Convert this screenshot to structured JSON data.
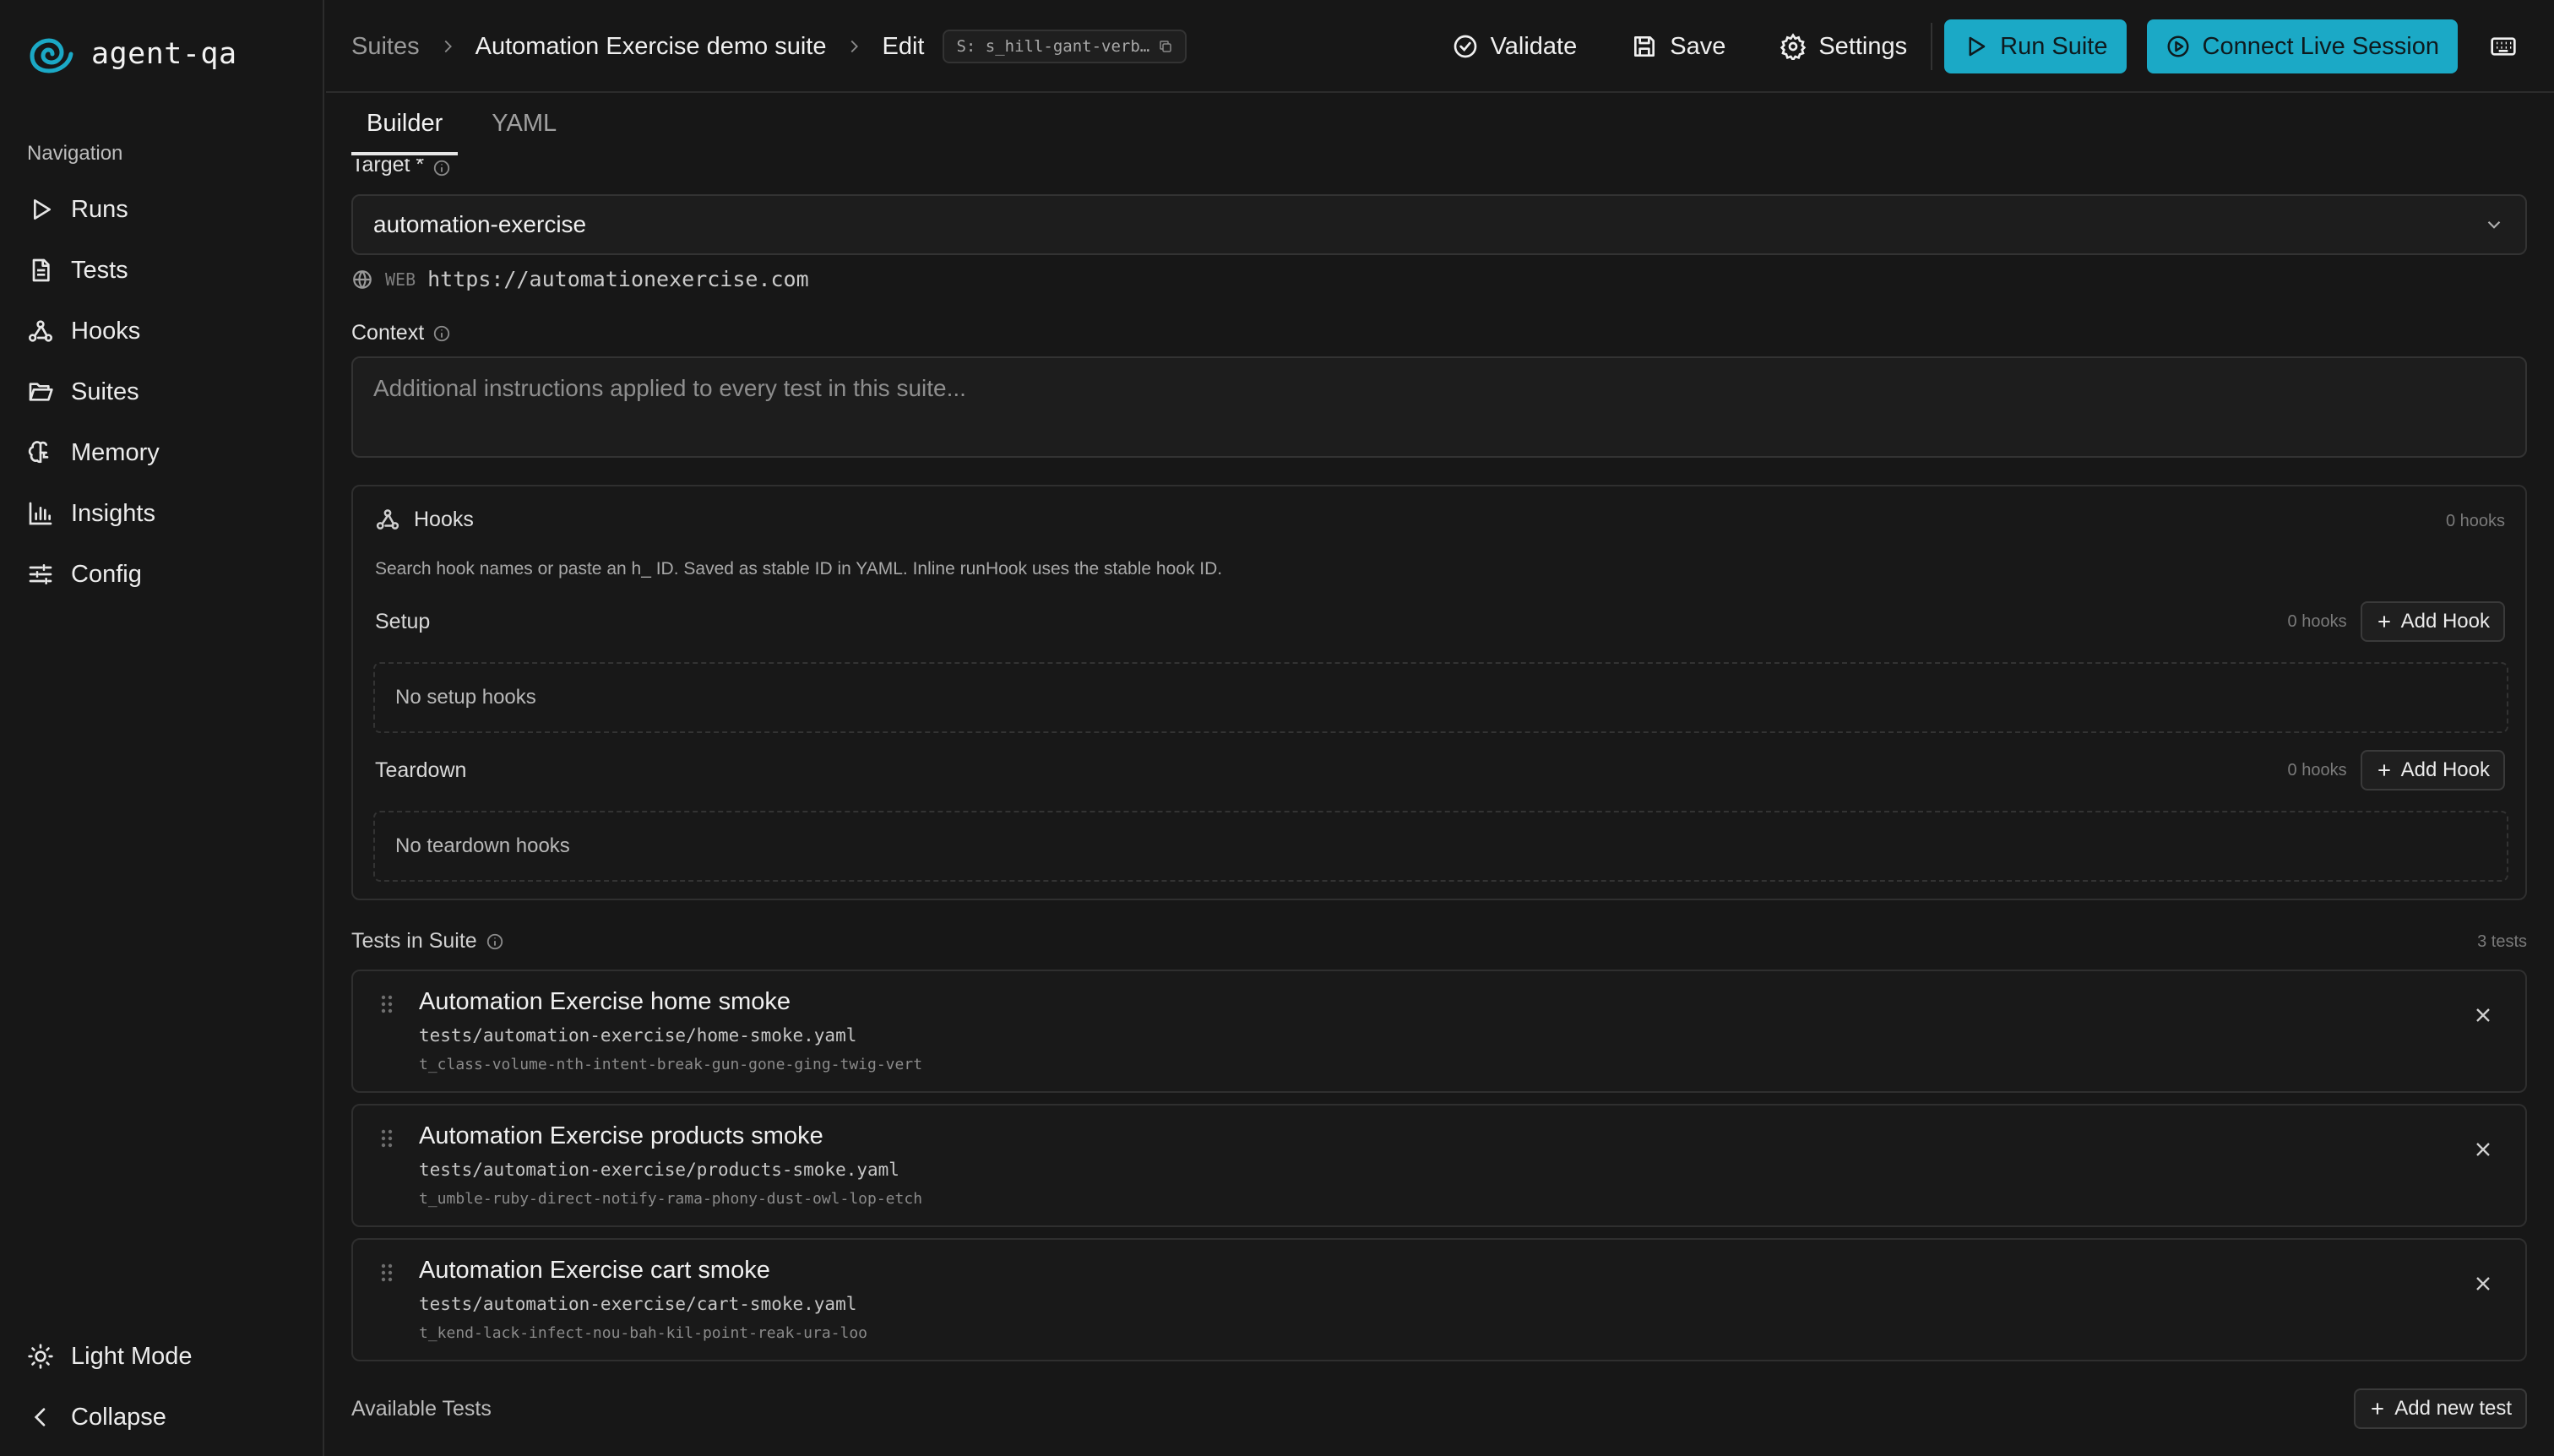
{
  "app": {
    "name": "agent-qa"
  },
  "sidebar": {
    "heading": "Navigation",
    "items": [
      {
        "label": "Runs",
        "icon": "play-icon"
      },
      {
        "label": "Tests",
        "icon": "file-text-icon"
      },
      {
        "label": "Hooks",
        "icon": "webhook-icon"
      },
      {
        "label": "Suites",
        "icon": "folder-open-icon"
      },
      {
        "label": "Memory",
        "icon": "brain-icon"
      },
      {
        "label": "Insights",
        "icon": "bar-chart-icon"
      },
      {
        "label": "Config",
        "icon": "sliders-icon"
      }
    ],
    "light_mode": "Light Mode",
    "collapse": "Collapse"
  },
  "header": {
    "crumb_suites": "Suites",
    "crumb_suite_name": "Automation Exercise demo suite",
    "crumb_edit": "Edit",
    "suite_id": "S: s_hill-gant-verb…",
    "validate": "Validate",
    "save": "Save",
    "settings": "Settings",
    "run_suite": "Run Suite",
    "connect_live": "Connect Live Session"
  },
  "tabs": {
    "builder": "Builder",
    "yaml": "YAML"
  },
  "form": {
    "target_label": "Target *",
    "target_value": "automation-exercise",
    "target_type": "WEB",
    "target_url": "https://automationexercise.com",
    "context_label": "Context",
    "context_placeholder": "Additional instructions applied to every test in this suite..."
  },
  "hooks": {
    "title": "Hooks",
    "count": "0 hooks",
    "description": "Search hook names or paste an h_ ID. Saved as stable ID in YAML. Inline runHook uses the stable hook ID.",
    "setup_label": "Setup",
    "setup_count": "0 hooks",
    "setup_empty": "No setup hooks",
    "teardown_label": "Teardown",
    "teardown_count": "0 hooks",
    "teardown_empty": "No teardown hooks",
    "add_hook": "Add Hook"
  },
  "tests_in_suite": {
    "title": "Tests in Suite",
    "count": "3 tests",
    "items": [
      {
        "title": "Automation Exercise home smoke",
        "path": "tests/automation-exercise/home-smoke.yaml",
        "id": "t_class-volume-nth-intent-break-gun-gone-ging-twig-vert"
      },
      {
        "title": "Automation Exercise products smoke",
        "path": "tests/automation-exercise/products-smoke.yaml",
        "id": "t_umble-ruby-direct-notify-rama-phony-dust-owl-lop-etch"
      },
      {
        "title": "Automation Exercise cart smoke",
        "path": "tests/automation-exercise/cart-smoke.yaml",
        "id": "t_kend-lack-infect-nou-bah-kil-point-reak-ura-loo"
      }
    ]
  },
  "available_tests": {
    "title": "Available Tests",
    "add_new": "Add new test"
  },
  "colors": {
    "accent": "#1ba9c6",
    "background": "#171717",
    "border": "#2f2f2f"
  }
}
